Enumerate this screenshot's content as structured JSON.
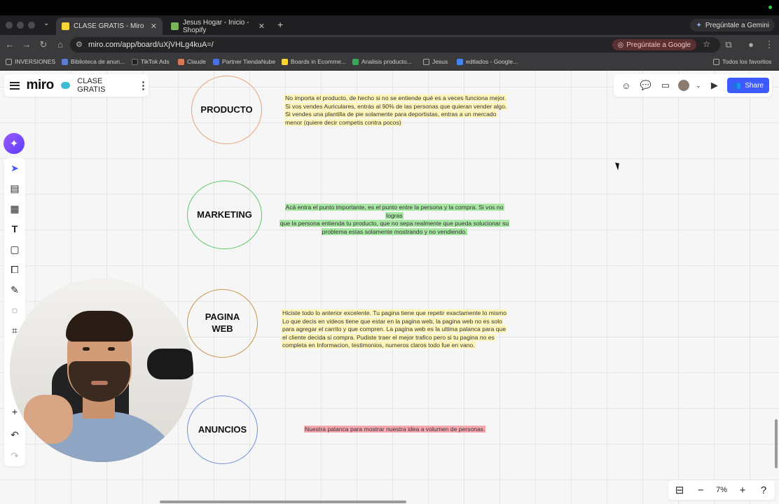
{
  "browser": {
    "tabs": [
      {
        "title": "CLASE GRATIS - Miro",
        "active": true,
        "favicon_color": "#f7d43a"
      },
      {
        "title": "Jesus Hogar - Inicio - Shopify",
        "active": false,
        "favicon_color": "#7ab55c"
      }
    ],
    "gemini_label": "Pregúntale a Gemini",
    "url": "miro.com/app/board/uXjVHLg4kuA=/",
    "ask_google_label": "Pregúntale a Google",
    "bookmarks": [
      "INVERSIONES",
      "Biblioteca de anun...",
      "TikTok Ads",
      "Claude",
      "Partner TiendaNube",
      "Boards in Ecomme...",
      "Analisis producto...",
      "Jesus",
      "edtlados - Google...",
      "Todos los favoritos"
    ]
  },
  "miro": {
    "logo": "miro",
    "board_name": "CLASE GRATIS",
    "share_label": "Share",
    "zoom": "7%",
    "accent": "#3d5afe"
  },
  "sections": [
    {
      "label": "PRODUCTO",
      "border_color": "#e8a27a",
      "note_color": "yellow",
      "lines": [
        "No importa el producto, de hecho si no se entiende qué es a veces funciona mejor.",
        "Si vos vendes Auriculares, entrás al 90% de las personas que quieran vender algo.",
        "Si vendes una plantilla de pie solamente para deportistas, entras a un mercado",
        "menor (quiere decir competis contra pocos)"
      ]
    },
    {
      "label": "MARKETING",
      "border_color": "#5cc66a",
      "note_color": "green",
      "lines": [
        "Acá entra el punto importante, es el punto entre la persona y la compra. Si vos no",
        "logras",
        "que la persona entienda tu producto, que no sepa realmente que pueda solucionar su",
        "problema estas solamente mostrando y no vendiendo."
      ]
    },
    {
      "label": "PAGINA WEB",
      "border_color": "#c9944a",
      "note_color": "yellow",
      "lines": [
        "Hiciste todo lo anterior excelente. Tu pagina tiene que repetir exactamente lo mismo",
        "Lo que decis en videos tiene que estar en la pagina web, la pagina web no es solo",
        "para agregar el carrito y que compren. La pagina web es la ultima palanca para que",
        "el cliente decida si compra. Pudiste traer el mejor trafico pero si tu pagina no es",
        "completa en Informacion, testimonios, numeros claros todo fue en vano."
      ]
    },
    {
      "label": "ANUNCIOS",
      "border_color": "#6f8fdc",
      "note_color": "red",
      "lines": [
        "Nuestra palanca para mostrar nuestra idea a volumen de personas."
      ]
    }
  ]
}
